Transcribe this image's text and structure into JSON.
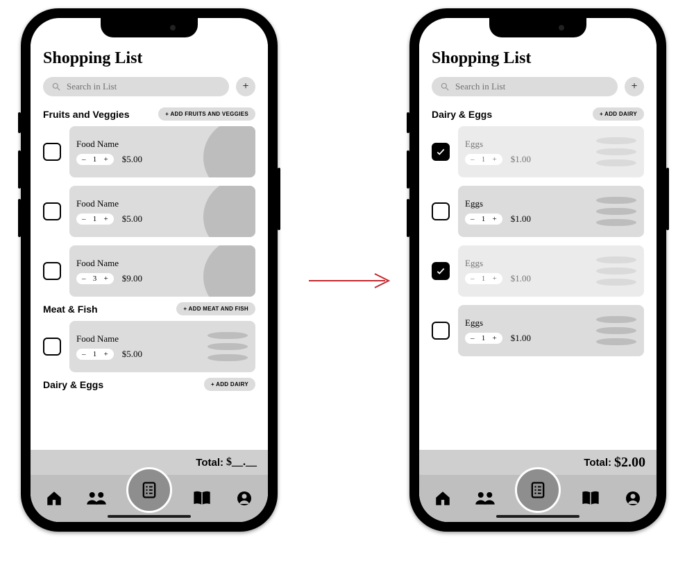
{
  "left": {
    "title": "Shopping List",
    "search": {
      "placeholder": "Search in List"
    },
    "cats": [
      {
        "name": "Fruits and Veggies",
        "add": "+ ADD FRUITS AND VEGGIES",
        "style": "bubble",
        "items": [
          {
            "name": "Food Name",
            "qty": 1,
            "price": "$5.00",
            "checked": false,
            "dim": false
          },
          {
            "name": "Food Name",
            "qty": 1,
            "price": "$5.00",
            "checked": false,
            "dim": false
          },
          {
            "name": "Food Name",
            "qty": 3,
            "price": "$9.00",
            "checked": false,
            "dim": false
          }
        ]
      },
      {
        "name": "Meat & Fish",
        "add": "+ ADD MEAT AND FISH",
        "style": "waves",
        "items": [
          {
            "name": "Food Name",
            "qty": 1,
            "price": "$5.00",
            "checked": false,
            "dim": false
          }
        ]
      },
      {
        "name": "Dairy & Eggs",
        "add": "+ ADD DAIRY",
        "style": "waves",
        "items": []
      }
    ],
    "total": {
      "label": "Total:",
      "amount": "$__.__ "
    }
  },
  "right": {
    "title": "Shopping List",
    "search": {
      "placeholder": "Search in List"
    },
    "cats": [
      {
        "name": "Dairy & Eggs",
        "add": "+ ADD DAIRY",
        "style": "waves",
        "items": [
          {
            "name": "Eggs",
            "qty": 1,
            "price": "$1.00",
            "checked": true,
            "dim": true
          },
          {
            "name": "Eggs",
            "qty": 1,
            "price": "$1.00",
            "checked": false,
            "dim": false
          },
          {
            "name": "Eggs",
            "qty": 1,
            "price": "$1.00",
            "checked": true,
            "dim": true
          },
          {
            "name": "Eggs",
            "qty": 1,
            "price": "$1.00",
            "checked": false,
            "dim": false
          }
        ]
      }
    ],
    "total": {
      "label": "Total:",
      "amount": "$2.00"
    }
  },
  "glyphs": {
    "minus": "–",
    "plus": "+"
  }
}
